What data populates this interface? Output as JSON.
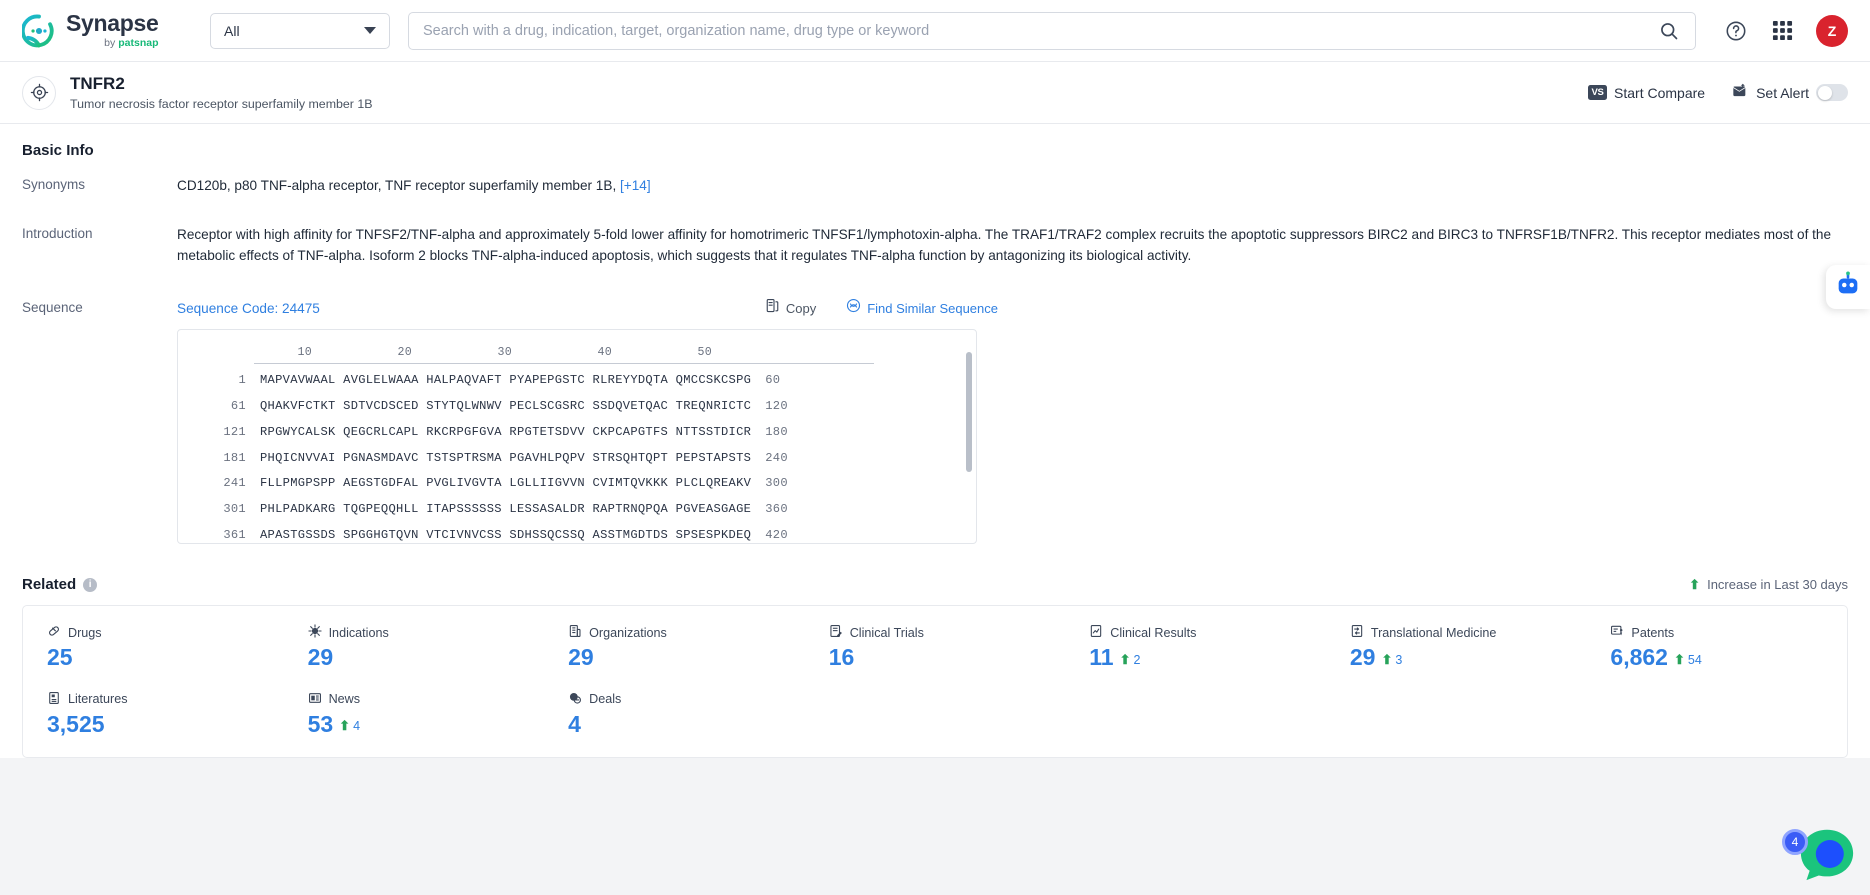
{
  "header": {
    "brand_name": "Synapse",
    "brand_by": "by",
    "brand_company": "patsnap",
    "scope_value": "All",
    "search_placeholder": "Search with a drug, indication, target, organization name, drug type or keyword",
    "search_value": "",
    "help_icon": "question-circle-icon",
    "apps_icon": "grid-apps-icon",
    "avatar_initial": "Z"
  },
  "entity": {
    "icon": "target-icon",
    "name": "TNFR2",
    "description": "Tumor necrosis factor receptor superfamily member 1B",
    "compare_label": "Start Compare",
    "compare_badge": "VS",
    "alert_label": "Set Alert",
    "alert_on": false
  },
  "basic_info": {
    "title": "Basic Info",
    "synonyms_label": "Synonyms",
    "synonyms_value": "CD120b,  p80 TNF-alpha receptor,  TNF receptor superfamily member 1B,",
    "synonyms_more": "[+14]",
    "introduction_label": "Introduction",
    "introduction_value": "Receptor with high affinity for TNFSF2/TNF-alpha and approximately 5-fold lower affinity for homotrimeric TNFSF1/lymphotoxin-alpha. The TRAF1/TRAF2 complex recruits the apoptotic suppressors BIRC2 and BIRC3 to TNFRSF1B/TNFR2. This receptor mediates most of the metabolic effects of TNF-alpha. Isoform 2 blocks TNF-alpha-induced apoptosis, which suggests that it regulates TNF-alpha function by antagonizing its biological activity.",
    "sequence_label": "Sequence",
    "sequence_code": "Sequence Code: 24475",
    "copy_label": "Copy",
    "copy_icon": "copy-icon",
    "find_similar_label": "Find Similar Sequence",
    "find_similar_icon": "find-similar-icon"
  },
  "sequence": {
    "ruler_ticks": [
      "10",
      "20",
      "30",
      "40",
      "50"
    ],
    "rows": [
      {
        "start": "1",
        "chunks": "MAPVAVWAAL AVGLELWAAA HALPAQVAFT PYAPEPGSTC RLREYYDQTA QMCCSKCSPG",
        "end": "60"
      },
      {
        "start": "61",
        "chunks": "QHAKVFCTKT SDTVCDSCED STYTQLWNWV PECLSCGSRC SSDQVETQAC TREQNRICTC",
        "end": "120"
      },
      {
        "start": "121",
        "chunks": "RPGWYCALSK QEGCRLCAPL RKCRPGFGVA RPGTETSDVV CKPCAPGTFS NTTSSTDICR",
        "end": "180"
      },
      {
        "start": "181",
        "chunks": "PHQICNVVAI PGNASMDAVC TSTSPTRSMA PGAVHLPQPV STRSQHTQPT PEPSTAPSTS",
        "end": "240"
      },
      {
        "start": "241",
        "chunks": "FLLPMGPSPP AEGSTGDFAL PVGLIVGVTA LGLLIIGVVN CVIMTQVKKK PLCLQREAKV",
        "end": "300"
      },
      {
        "start": "301",
        "chunks": "PHLPADKARG TQGPEQQHLL ITAPSSSSSS LESSASALDR RAPTRNQPQA PGVEASGAGE",
        "end": "360"
      },
      {
        "start": "361",
        "chunks": "APASTGSSDS SPGGHGTQVN VTCIVNVCSS SDHSSQCSSQ ASSTMGDTDS SPSESPKDEQ",
        "end": "420"
      }
    ]
  },
  "related": {
    "title": "Related",
    "info_icon": "info-icon",
    "legend_arrow": "up-arrow-icon",
    "legend_label": "Increase in Last 30 days",
    "stats": [
      {
        "icon": "capsule-icon",
        "label": "Drugs",
        "value": "25",
        "delta": ""
      },
      {
        "icon": "virus-icon",
        "label": "Indications",
        "value": "29",
        "delta": ""
      },
      {
        "icon": "building-icon",
        "label": "Organizations",
        "value": "29",
        "delta": ""
      },
      {
        "icon": "clinical-trial-icon",
        "label": "Clinical Trials",
        "value": "16",
        "delta": ""
      },
      {
        "icon": "clinical-result-icon",
        "label": "Clinical Results",
        "value": "11",
        "delta": "2"
      },
      {
        "icon": "translational-icon",
        "label": "Translational Medicine",
        "value": "29",
        "delta": "3"
      },
      {
        "icon": "patent-icon",
        "label": "Patents",
        "value": "6,862",
        "delta": "54"
      },
      {
        "icon": "literature-icon",
        "label": "Literatures",
        "value": "3,525",
        "delta": ""
      },
      {
        "icon": "news-icon",
        "label": "News",
        "value": "53",
        "delta": "4"
      },
      {
        "icon": "deal-icon",
        "label": "Deals",
        "value": "4",
        "delta": ""
      }
    ]
  },
  "floating": {
    "side_widget_icon": "assistant-bot-icon",
    "chat_badge": "4",
    "chat_icon": "chat-bubble-icon"
  },
  "colors": {
    "accent_blue": "#2f7fe0",
    "increase_green": "#27a35a",
    "avatar_red": "#d9232e",
    "brand_dark": "#2b3445"
  }
}
